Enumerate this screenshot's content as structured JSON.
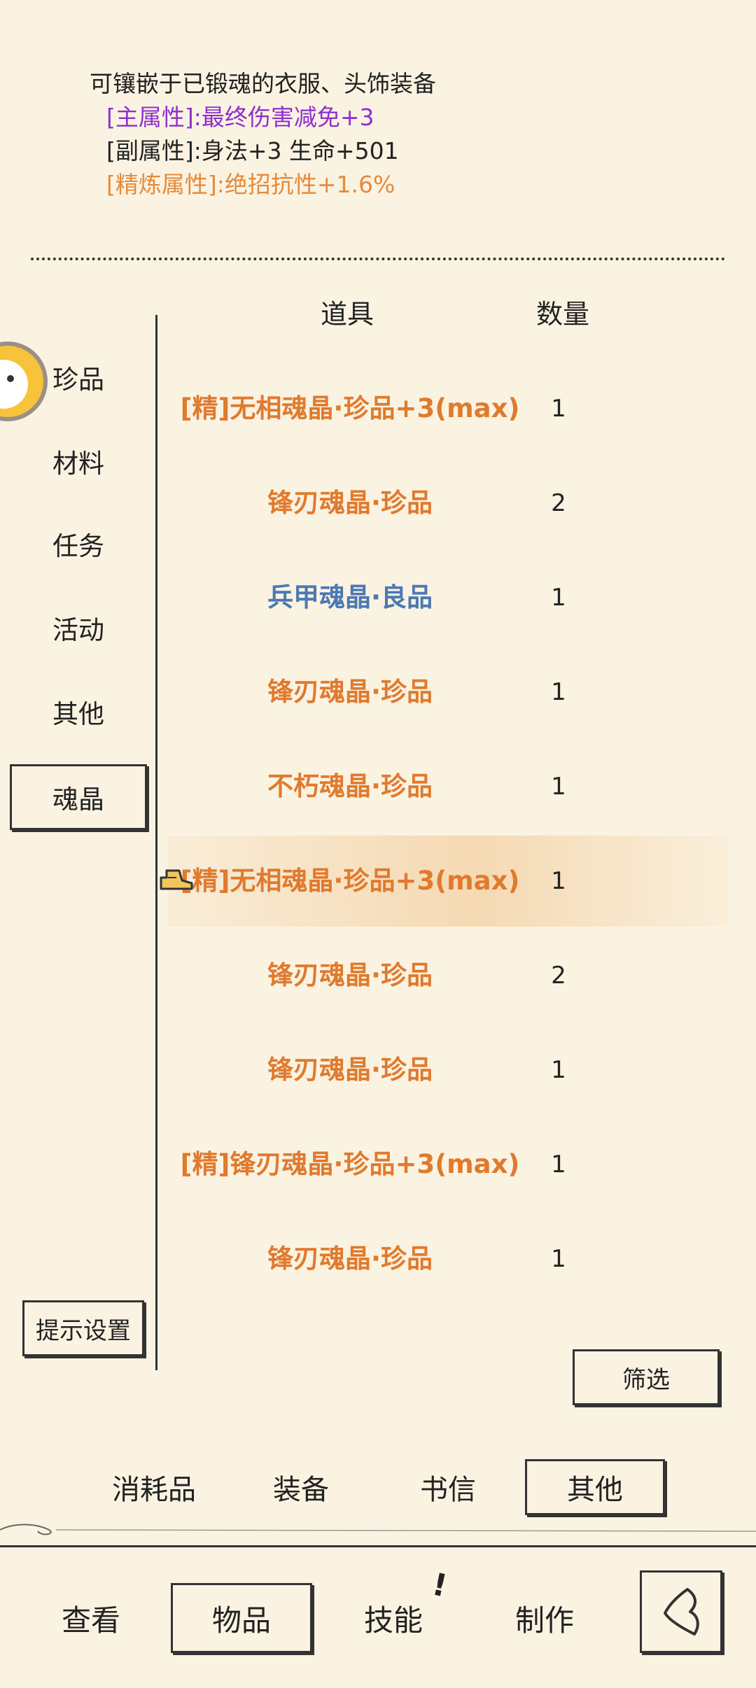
{
  "description": {
    "line1": "可镶嵌于已锻魂的衣服、头饰装备",
    "main_attr": "[主属性]:最终伤害减免+3",
    "sub_attr": "[副属性]:身法+3 生命+501",
    "refine_attr": "[精炼属性]:绝招抗性+1.6%"
  },
  "table_header": {
    "item": "道具",
    "quantity": "数量"
  },
  "categories": [
    "珍品",
    "材料",
    "任务",
    "活动",
    "其他",
    "魂晶"
  ],
  "active_category": "魂晶",
  "items": [
    {
      "name": "[精]无相魂晶·珍品+3(max)",
      "qty": "1",
      "color": "#e07a2e"
    },
    {
      "name": "锋刃魂晶·珍品",
      "qty": "2",
      "color": "#e07a2e"
    },
    {
      "name": "兵甲魂晶·良品",
      "qty": "1",
      "color": "#4d78b4"
    },
    {
      "name": "锋刃魂晶·珍品",
      "qty": "1",
      "color": "#e07a2e"
    },
    {
      "name": "不朽魂晶·珍品",
      "qty": "1",
      "color": "#e07a2e"
    },
    {
      "name": "[精]无相魂晶·珍品+3(max)",
      "qty": "1",
      "color": "#e07a2e",
      "selected": true
    },
    {
      "name": "锋刃魂晶·珍品",
      "qty": "2",
      "color": "#e07a2e"
    },
    {
      "name": "锋刃魂晶·珍品",
      "qty": "1",
      "color": "#e07a2e"
    },
    {
      "name": "[精]锋刃魂晶·珍品+3(max)",
      "qty": "1",
      "color": "#e07a2e"
    },
    {
      "name": "锋刃魂晶·珍品",
      "qty": "1",
      "color": "#e07a2e"
    }
  ],
  "buttons": {
    "hint_settings": "提示设置",
    "filter": "筛选"
  },
  "bag_tabs": [
    "消耗品",
    "装备",
    "书信",
    "其他"
  ],
  "active_bag_tab": "其他",
  "nav": [
    "查看",
    "物品",
    "技能",
    "制作"
  ],
  "active_nav": "物品",
  "nav_badge": "!",
  "icons": [
    "avatar",
    "shoe-icon",
    "back-icon"
  ]
}
